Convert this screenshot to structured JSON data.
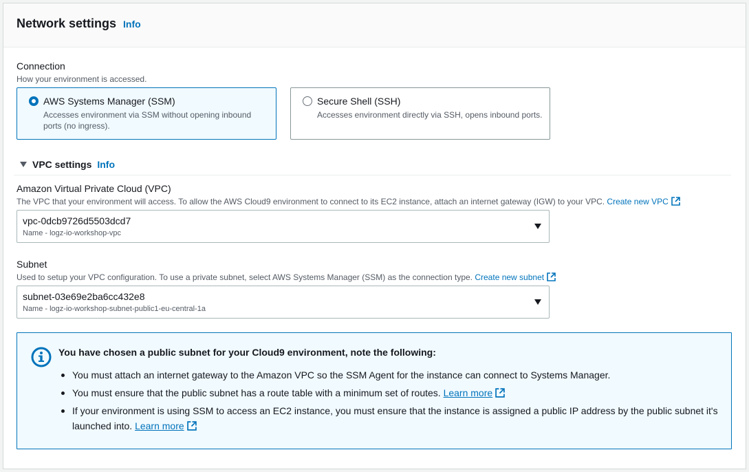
{
  "header": {
    "title": "Network settings",
    "info": "Info"
  },
  "connection": {
    "label": "Connection",
    "description": "How your environment is accessed.",
    "options": [
      {
        "title": "AWS Systems Manager (SSM)",
        "description": "Accesses environment via SSM without opening inbound ports (no ingress).",
        "selected": true
      },
      {
        "title": "Secure Shell (SSH)",
        "description": "Accesses environment directly via SSH, opens inbound ports.",
        "selected": false
      }
    ]
  },
  "vpc_settings": {
    "title": "VPC settings",
    "info": "Info"
  },
  "vpc": {
    "label": "Amazon Virtual Private Cloud (VPC)",
    "description": "The VPC that your environment will access. To allow the AWS Cloud9 environment to connect to its EC2 instance, attach an internet gateway (IGW) to your VPC.",
    "create_link": "Create new VPC",
    "value": "vpc-0dcb9726d5503dcd7",
    "value_sub": "Name - logz-io-workshop-vpc"
  },
  "subnet": {
    "label": "Subnet",
    "description": "Used to setup your VPC configuration. To use a private subnet, select AWS Systems Manager (SSM) as the connection type.",
    "create_link": "Create new subnet",
    "value": "subnet-03e69e2ba6cc432e8",
    "value_sub": "Name - logz-io-workshop-subnet-public1-eu-central-1a"
  },
  "alert": {
    "title_pre": "You have chosen a ",
    "title_bold": "public",
    "title_post": " subnet for your Cloud9 environment, note the following:",
    "item1": "You must attach an internet gateway to the Amazon VPC so the SSM Agent for the instance can connect to Systems Manager.",
    "item2": "You must ensure that the public subnet has a route table with a minimum set of routes.",
    "item2_link": "Learn more",
    "item3": "If your environment is using SSM to access an EC2 instance, you must ensure that the instance is assigned a public IP address by the public subnet it's launched into.",
    "item3_link": "Learn more"
  },
  "colors": {
    "accent": "#0073bb",
    "alert_bg": "#f1faff",
    "text": "#16191f",
    "muted": "#545b64"
  }
}
